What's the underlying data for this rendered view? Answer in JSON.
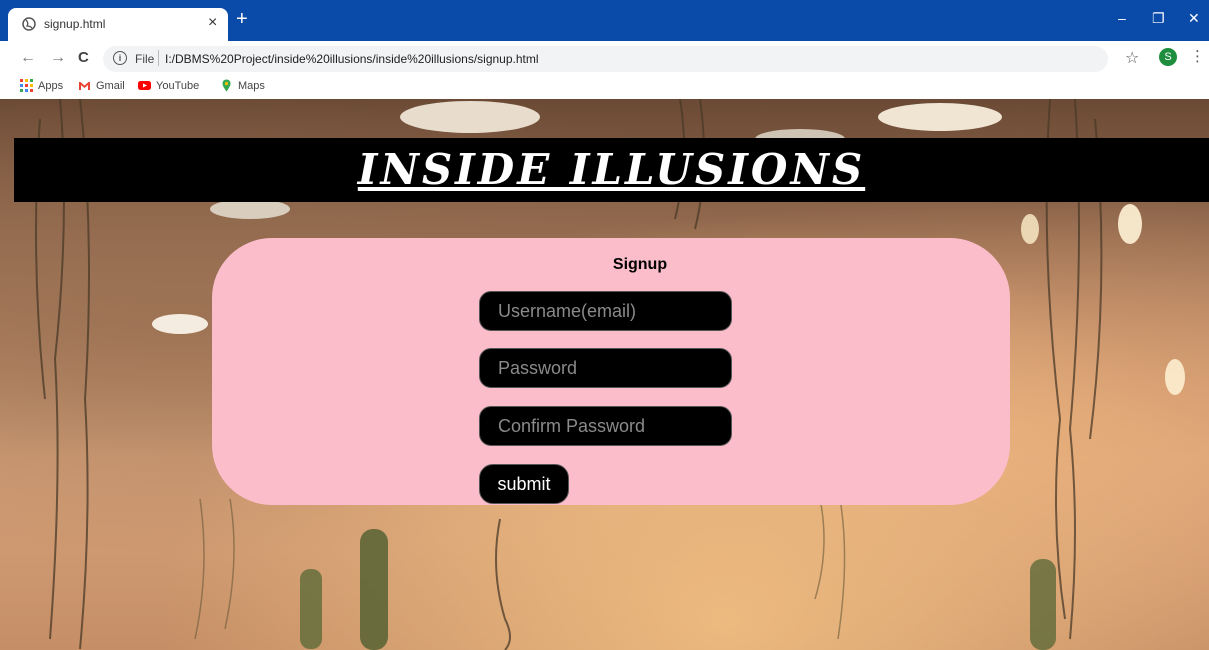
{
  "browser": {
    "tab_title": "signup.html",
    "tab_close": "×",
    "new_tab": "+",
    "window_controls": {
      "minimize": "–",
      "restore": "❐",
      "close": "✕"
    },
    "nav": {
      "back": "←",
      "forward": "→",
      "reload": "C"
    },
    "omnibox": {
      "info": "i",
      "scheme": "File",
      "url": "I:/DBMS%20Project/inside%20illusions/inside%20illusions/signup.html"
    },
    "star": "☆",
    "avatar_initial": "S",
    "menu": "⋮",
    "bookmarks": [
      "Apps",
      "Gmail",
      "YouTube",
      "Maps"
    ]
  },
  "page": {
    "site_title": "INSIDE ILLUSIONS",
    "form": {
      "heading": "Signup",
      "username_placeholder": "Username(email)",
      "password_placeholder": "Password",
      "confirm_placeholder": "Confirm Password",
      "submit_label": "submit"
    }
  },
  "colors": {
    "tabbar": "#0a4aa8",
    "banner": "#000000",
    "panel": "#fbbdca",
    "avatar": "#1e8e3e"
  }
}
